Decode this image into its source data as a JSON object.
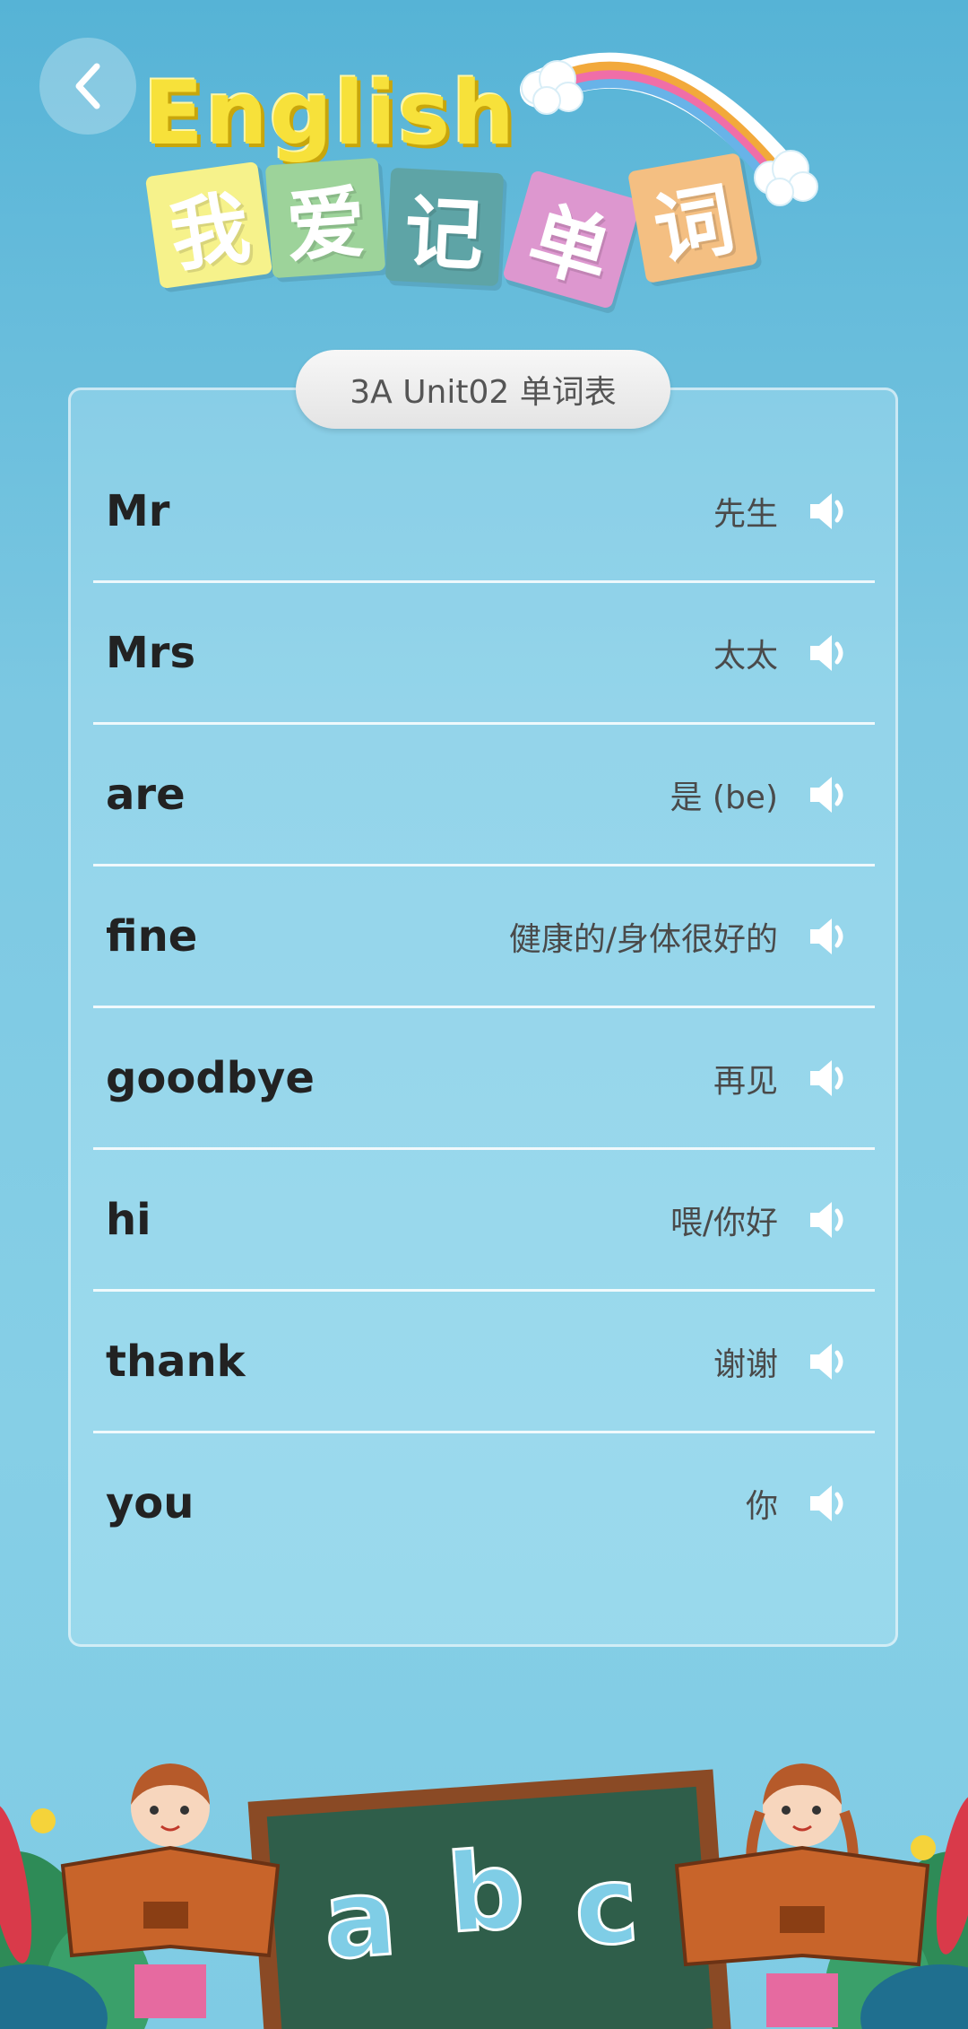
{
  "header": {
    "brand_english": "English",
    "brand_chars": [
      "我",
      "爱",
      "记",
      "单",
      "词"
    ]
  },
  "wordlist": {
    "title": "3A Unit02 单词表",
    "items": [
      {
        "word": "Mr",
        "meaning": "先生"
      },
      {
        "word": "Mrs",
        "meaning": "太太"
      },
      {
        "word": "are",
        "meaning": "是 (be)"
      },
      {
        "word": "fine",
        "meaning": "健康的/身体很好的"
      },
      {
        "word": "goodbye",
        "meaning": "再见"
      },
      {
        "word": "hi",
        "meaning": "喂/你好"
      },
      {
        "word": "thank",
        "meaning": "谢谢"
      },
      {
        "word": "you",
        "meaning": "你"
      }
    ]
  },
  "illustration": {
    "chalkboard_letters": [
      "a",
      "b",
      "c"
    ]
  },
  "icons": {
    "back": "chevron-left-icon",
    "speaker": "speaker-icon"
  },
  "colors": {
    "background_top": "#56b3d6",
    "background_bottom": "#86cfe6",
    "tile_1": "#f6f28b",
    "tile_2": "#9dd39a",
    "tile_3": "#5ea4a6",
    "tile_4": "#dd97cf",
    "tile_5": "#f4bf82",
    "english_yellow": "#f7e13a"
  }
}
